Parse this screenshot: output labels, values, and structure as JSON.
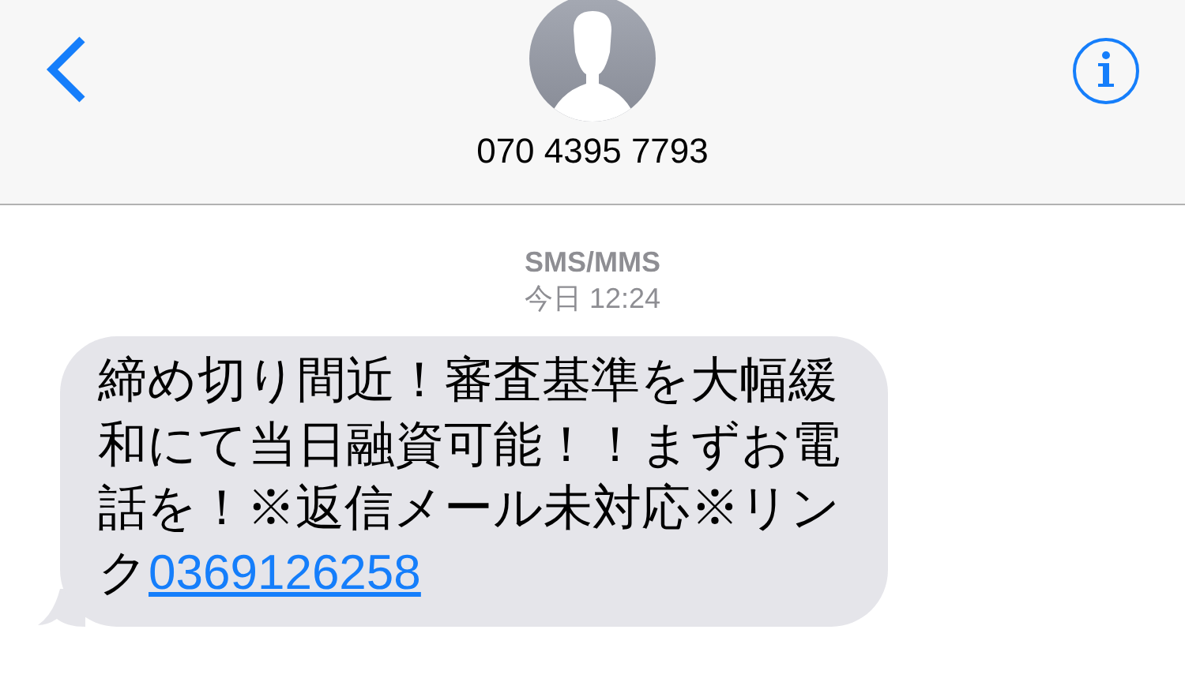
{
  "header": {
    "contact": "070 4395 7793"
  },
  "thread": {
    "service": "SMS/MMS",
    "timestamp": "今日 12:24"
  },
  "messages": [
    {
      "text": "締め切り間近！審査基準を大幅緩和にて当日融資可能！！まずお電話を！※返信メール未対応※リンク",
      "link": "0369126258"
    }
  ]
}
